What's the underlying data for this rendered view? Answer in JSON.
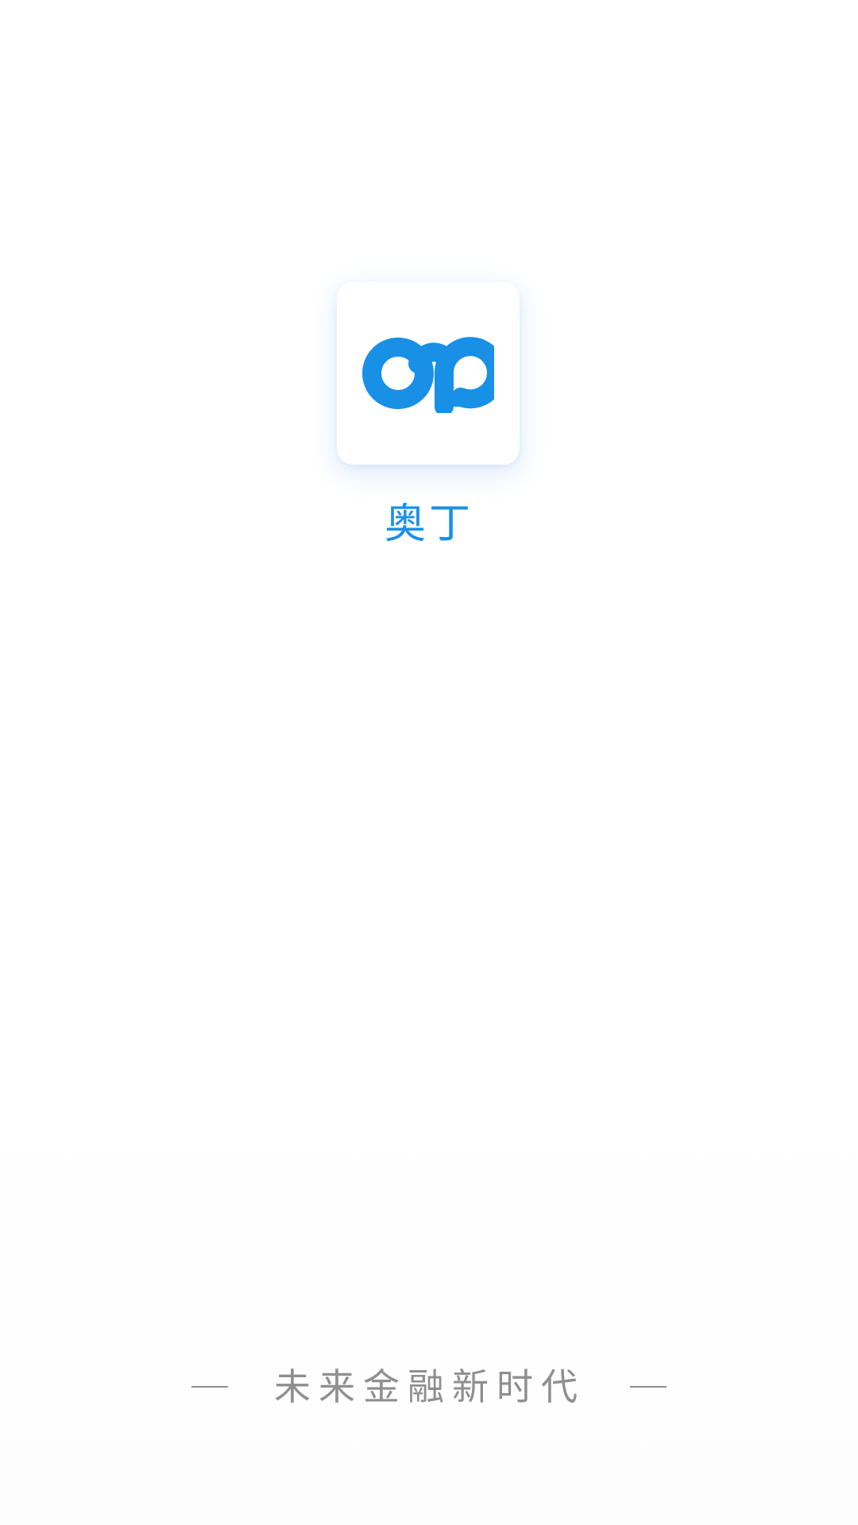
{
  "app": {
    "name": "奥丁",
    "logo_icon": "infinity-od-logo-icon",
    "tagline": "未来金融新时代"
  },
  "colors": {
    "brand": "#1890e6",
    "tagline": "#8f8f8f",
    "background": "#ffffff"
  }
}
